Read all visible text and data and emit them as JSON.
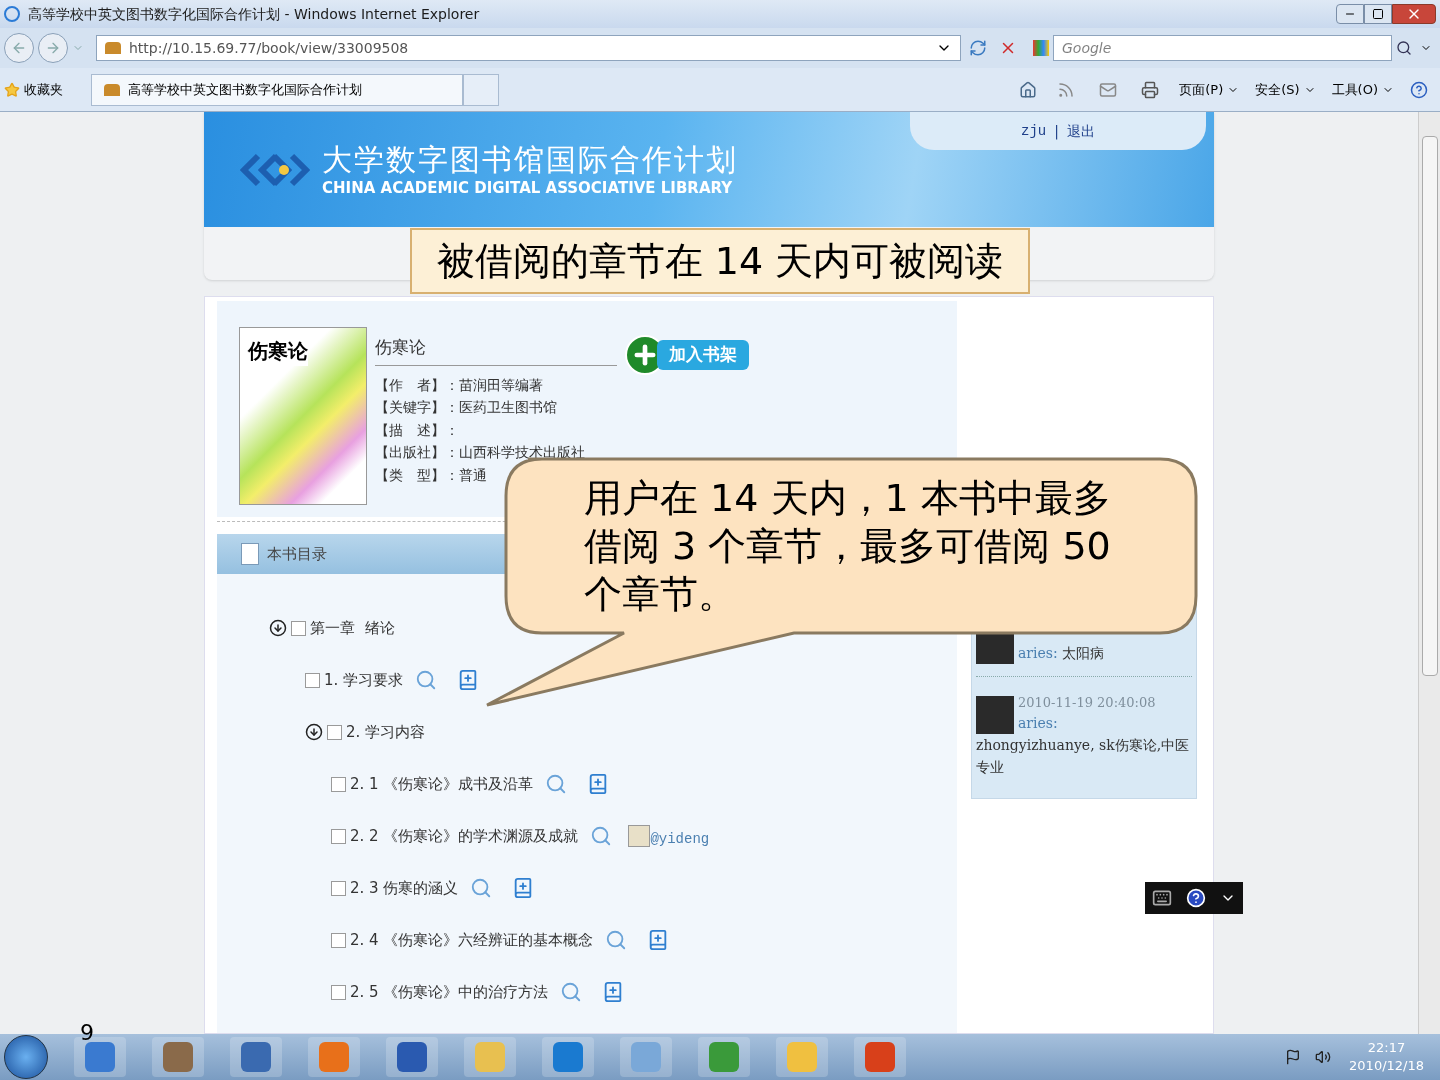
{
  "window": {
    "title": "高等学校中英文图书数字化国际合作计划 - Windows Internet Explorer"
  },
  "address_bar": {
    "url": "http://10.15.69.77/book/view/33009508",
    "search_placeholder": "Google"
  },
  "favorites_bar": {
    "favorites": "收藏夹",
    "tab": "高等学校中英文图书数字化国际合作计划",
    "menus": [
      "页面(P)",
      "安全(S)",
      "工具(O)"
    ]
  },
  "header": {
    "logo_cn": "大学数字图书馆国际合作计划",
    "logo_en": "CHINA ACADEMIC DIGITAL ASSOCIATIVE LIBRARY",
    "user": "zju",
    "separator": "|",
    "logout": "退出"
  },
  "book": {
    "title": "伤寒论",
    "cover_title": "伤寒论",
    "add_button": "加入书架",
    "fields": [
      {
        "label": "【作　者】：",
        "value": "苗润田等编著"
      },
      {
        "label": "【关键字】：",
        "value": "医药卫生图书馆"
      },
      {
        "label": "【描　述】："
      },
      {
        "label": "【出版社】：",
        "value": "山西科学技术出版社"
      },
      {
        "label": "【类　型】：",
        "value": "普通"
      }
    ]
  },
  "toc": {
    "header": "本书目录",
    "items": [
      {
        "label": "第一章  绪论",
        "checked": false,
        "expanded": true,
        "children": [
          {
            "label": "1. 学习要求",
            "checked": false,
            "kind": "available"
          },
          {
            "label": "2. 学习内容",
            "checked": false,
            "expanded": true,
            "children": [
              {
                "label": "2. 1 《伤寒论》成书及沿革",
                "checked": false,
                "kind": "available"
              },
              {
                "label": "2. 2 《伤寒论》的学术渊源及成就",
                "checked": false,
                "kind": "borrowed",
                "borrowed_by": "@yideng"
              },
              {
                "label": "2. 3 伤寒的涵义",
                "checked": false,
                "kind": "available"
              },
              {
                "label": "2. 4 《伤寒论》六经辨证的基本概念",
                "checked": false,
                "kind": "available"
              },
              {
                "label": "2. 5 《伤寒论》中的治疗方法",
                "checked": false,
                "kind": "available"
              }
            ]
          }
        ]
      }
    ]
  },
  "comments": [
    {
      "user": "aries:",
      "text": "太阳病"
    },
    {
      "time": "2010-11-19 20:40:08",
      "user": "aries:",
      "text": "zhongyizhuanye, sk伤寒论,中医专业"
    }
  ],
  "callouts": [
    {
      "kind": "banner",
      "text": "被借阅的章节在 14 天内可被阅读"
    },
    {
      "kind": "bubble",
      "text": "用户在 14 天内，1 本书中最多借阅 3 个章节，最多可借阅 50 个章节。"
    }
  ],
  "slide_number": "9",
  "taskbar": {
    "time": "22:17",
    "date": "2010/12/18"
  }
}
